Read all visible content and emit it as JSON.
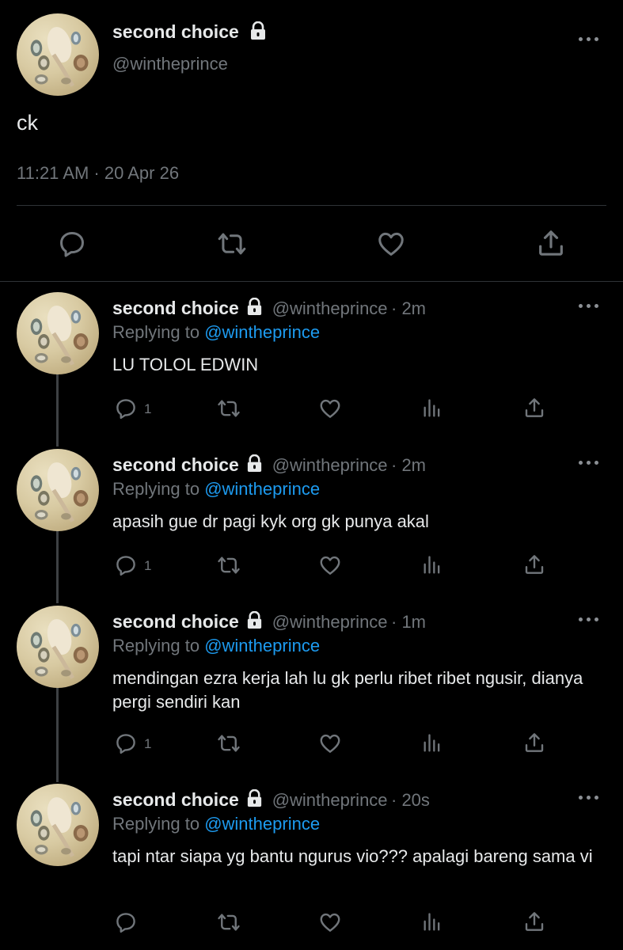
{
  "main_tweet": {
    "display_name": "second choice",
    "handle": "@wintheprince",
    "text": "ck",
    "timestamp": "11:21 AM · 20 Apr 26",
    "locked_icon": "lock-icon",
    "actions": [
      "reply-icon",
      "retweet-icon",
      "like-icon",
      "share-icon"
    ]
  },
  "replies": [
    {
      "display_name": "second choice",
      "handle": "@wintheprince",
      "time": "· 2m",
      "replying_label": "Replying to",
      "replying_handle": "@wintheprince",
      "text": "LU TOLOL EDWIN",
      "reply_count": "1"
    },
    {
      "display_name": "second choice",
      "handle": "@wintheprince",
      "time": "· 2m",
      "replying_label": "Replying to",
      "replying_handle": "@wintheprince",
      "text": "apasih gue dr pagi kyk org gk punya akal",
      "reply_count": "1"
    },
    {
      "display_name": "second choice",
      "handle": "@wintheprince",
      "time": "· 1m",
      "replying_label": "Replying to",
      "replying_handle": "@wintheprince",
      "text": "mendingan ezra kerja lah lu gk perlu ribet ribet ngusir, dianya pergi sendiri kan",
      "reply_count": "1"
    },
    {
      "display_name": "second choice",
      "handle": "@wintheprince",
      "time": "· 20s",
      "replying_label": "Replying to",
      "replying_handle": "@wintheprince",
      "text": "tapi ntar siapa yg bantu ngurus vio??? apalagi bareng sama vi",
      "reply_count": ""
    }
  ],
  "colors": {
    "background": "#000000",
    "text": "#e7e9ea",
    "muted": "#71767b",
    "link": "#1d9bf0",
    "divider": "#2f3336"
  }
}
